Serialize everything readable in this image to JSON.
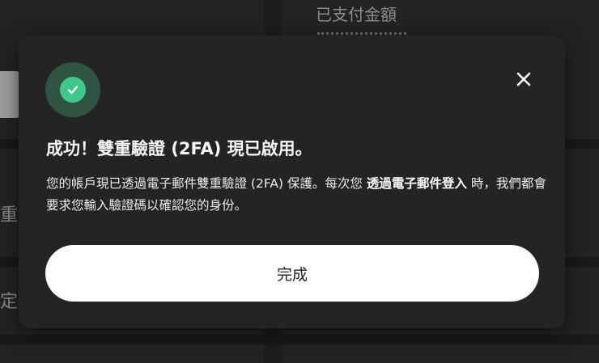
{
  "background": {
    "paid_amount_label": "已支付金額",
    "left_text_1": "重",
    "left_text_2": "定"
  },
  "modal": {
    "title": "成功！雙重驗證 (2FA) 現已啟用。",
    "body": {
      "part1": "您的帳戶現已透過電子郵件雙重驗證 (2FA) 保護。每次您",
      "highlight": "透過電子郵件登入",
      "part2": "時，我們都會要求您輸入驗證碼以確認您的身份。"
    },
    "done_label": "完成",
    "icons": {
      "success": "check-circle-icon",
      "close": "close-icon"
    }
  },
  "colors": {
    "success_green": "#3ec98a",
    "success_badge_bg": "#2f5444",
    "modal_bg": "#242424",
    "button_bg": "#ffffff"
  }
}
